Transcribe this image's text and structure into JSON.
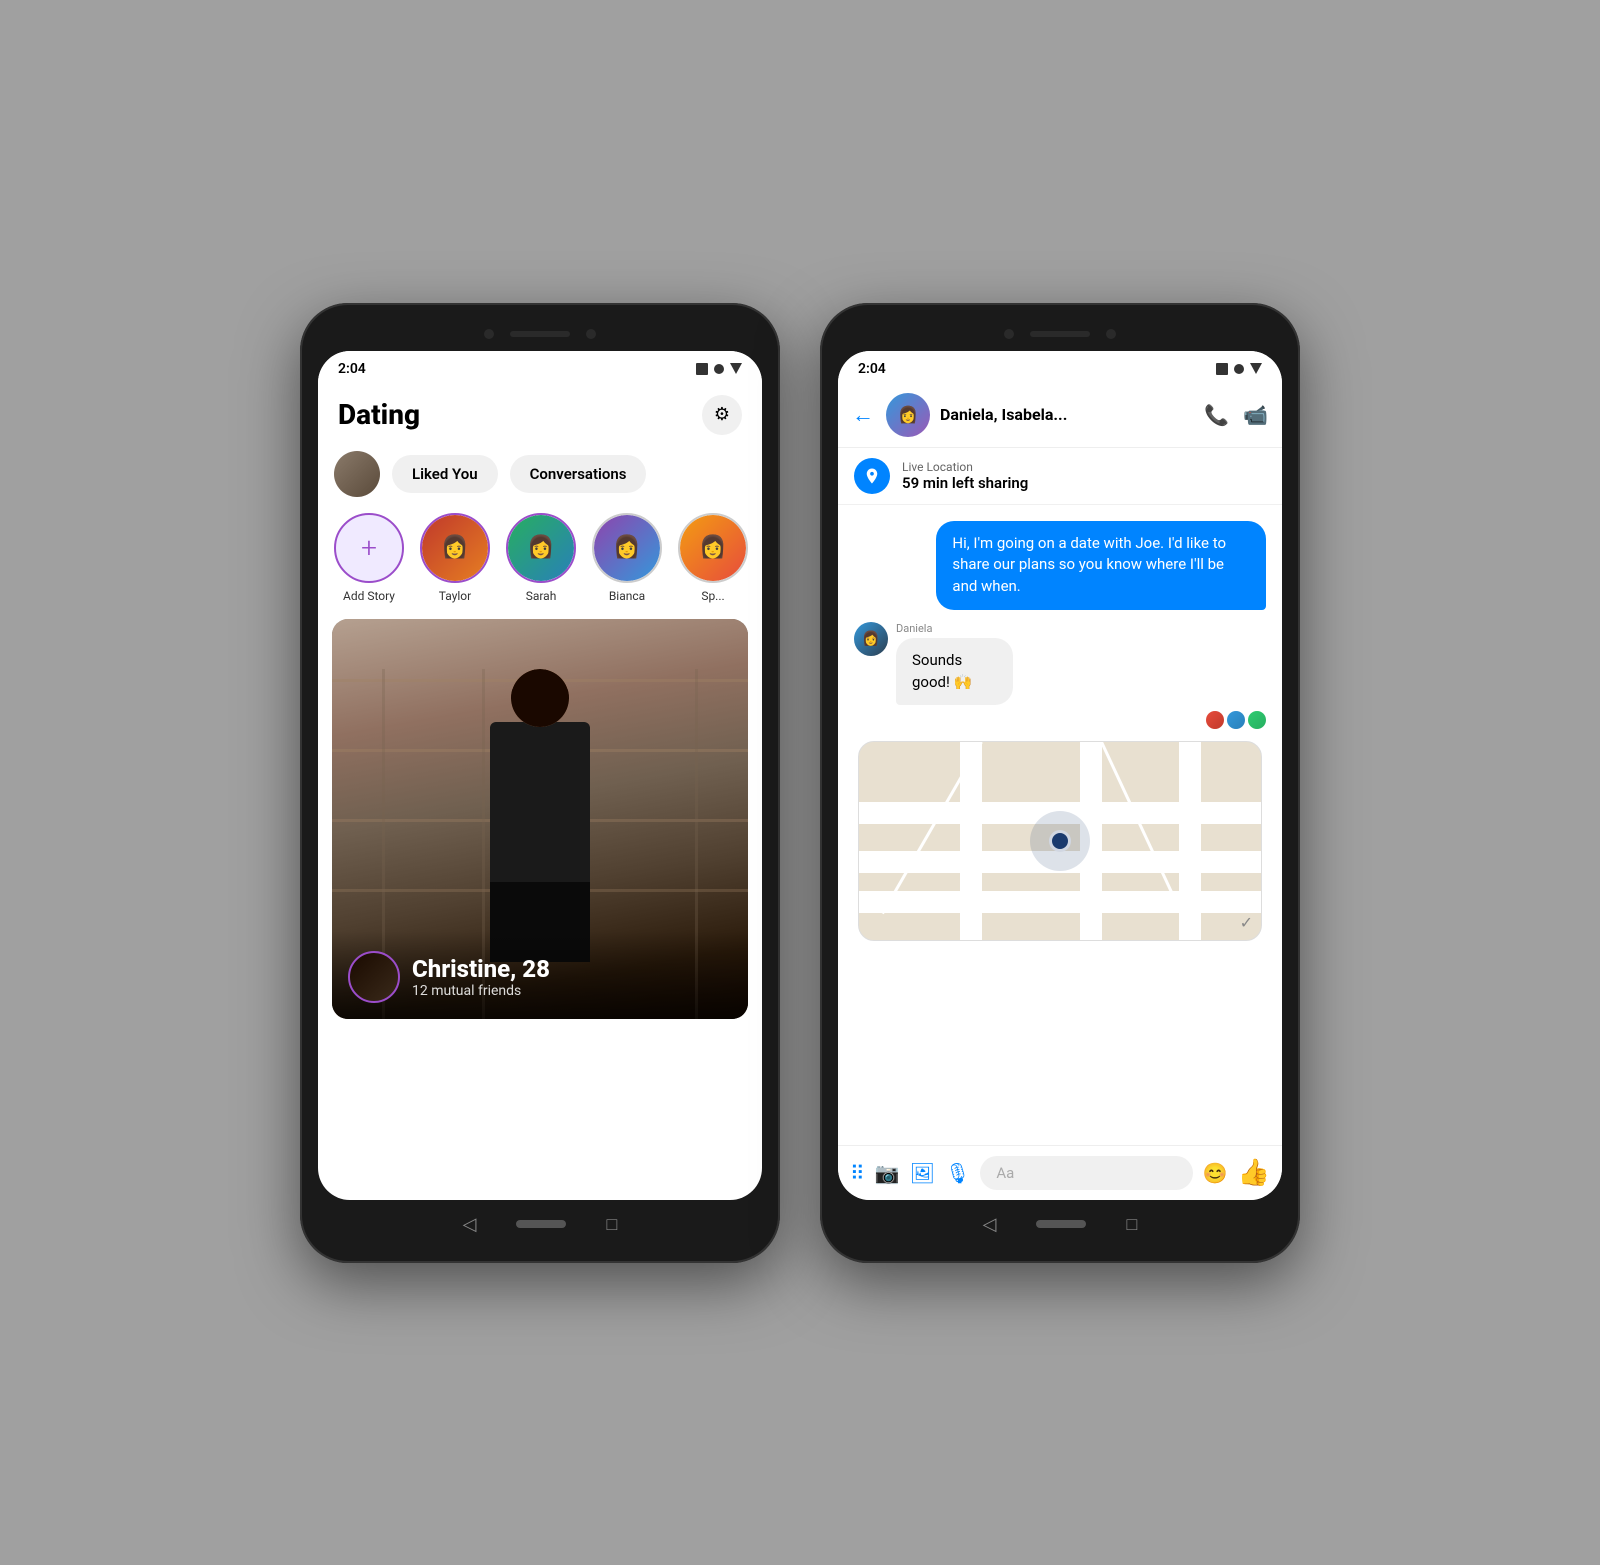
{
  "dating_phone": {
    "status_bar": {
      "time": "2:04"
    },
    "header": {
      "title": "Dating",
      "gear_label": "⚙"
    },
    "tabs": {
      "liked_you": "Liked You",
      "conversations": "Conversations"
    },
    "stories": [
      {
        "label": "Add Story",
        "type": "add"
      },
      {
        "label": "Taylor",
        "type": "story"
      },
      {
        "label": "Sarah",
        "type": "story"
      },
      {
        "label": "Bianca",
        "type": "story_gray"
      },
      {
        "label": "Sp...",
        "type": "story_gray"
      }
    ],
    "card": {
      "name": "Christine, 28",
      "sub": "12 mutual friends"
    }
  },
  "messenger_phone": {
    "status_bar": {
      "time": "2:04"
    },
    "header": {
      "name": "Daniela, Isabela...",
      "phone_icon": "📞",
      "video_icon": "📹"
    },
    "location_banner": {
      "label": "Live Location",
      "main": "59 min left sharing"
    },
    "messages": [
      {
        "type": "outgoing",
        "text": "Hi, I'm going on a date with Joe. I'd like to share our plans so you know where I'll be and when."
      },
      {
        "type": "incoming",
        "sender": "Daniela",
        "text": "Sounds good! 🙌"
      }
    ],
    "input_placeholder": "Aa"
  }
}
